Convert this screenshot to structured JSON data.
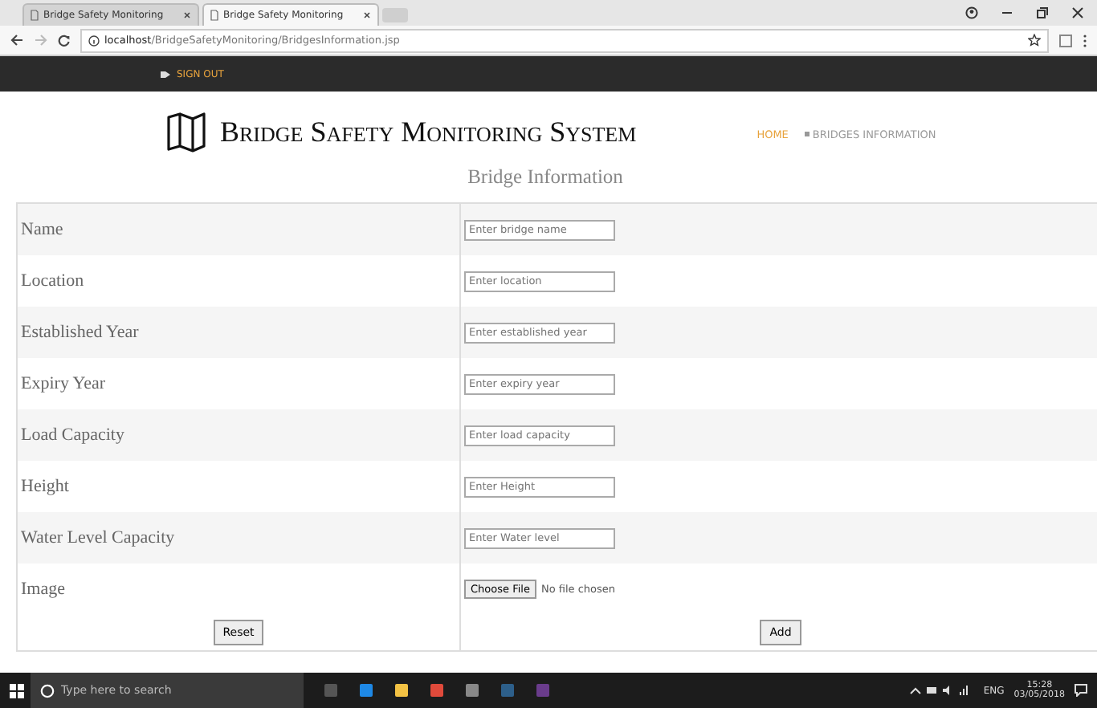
{
  "browser": {
    "tabs": [
      {
        "title": "Bridge Safety Monitoring",
        "selected": false
      },
      {
        "title": "Bridge Safety Monitoring",
        "selected": true
      }
    ],
    "address": {
      "host": "localhost",
      "path": "/BridgeSafetyMonitoring/BridgesInformation.jsp"
    }
  },
  "topbar": {
    "sign_out": "SIGN OUT"
  },
  "header": {
    "title": "Bridge Safety Monitoring System",
    "nav": [
      {
        "label": "HOME",
        "selected": true
      },
      {
        "label": "BRIDGES INFORMATION",
        "selected": false
      }
    ]
  },
  "heading": "Bridge Information",
  "form": {
    "rows": [
      {
        "kind": "text",
        "label": "Name",
        "placeholder": "Enter bridge name"
      },
      {
        "kind": "text",
        "label": "Location",
        "placeholder": "Enter location"
      },
      {
        "kind": "text",
        "label": "Established Year",
        "placeholder": "Enter established year"
      },
      {
        "kind": "text",
        "label": "Expiry Year",
        "placeholder": "Enter expiry year"
      },
      {
        "kind": "text",
        "label": "Load Capacity",
        "placeholder": "Enter load capacity"
      },
      {
        "kind": "text",
        "label": "Height",
        "placeholder": "Enter Height"
      },
      {
        "kind": "text",
        "label": "Water Level Capacity",
        "placeholder": "Enter Water level"
      },
      {
        "kind": "file",
        "label": "Image",
        "button": "Choose File",
        "status": "No file chosen"
      }
    ],
    "buttons": [
      "Reset",
      "Add"
    ]
  },
  "taskbar": {
    "search_placeholder": "Type here to search",
    "language": "ENG",
    "time": "15:28",
    "date": "03/05/2018"
  }
}
